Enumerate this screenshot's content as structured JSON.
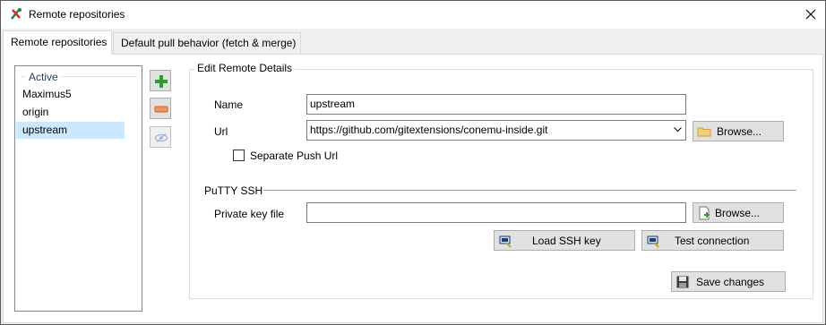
{
  "window": {
    "title": "Remote repositories",
    "close_label": "✕"
  },
  "tabs": [
    {
      "label": "Remote repositories",
      "active": true
    },
    {
      "label": "Default pull behavior (fetch & merge)",
      "active": false
    }
  ],
  "remotes": {
    "header": "Active",
    "items": [
      {
        "label": "Maximus5",
        "selected": false
      },
      {
        "label": "origin",
        "selected": false
      },
      {
        "label": "upstream",
        "selected": true
      }
    ]
  },
  "side_buttons": {
    "add": "add-icon",
    "remove": "remove-icon",
    "toggle": "eye-hidden-icon"
  },
  "details": {
    "legend": "Edit Remote Details",
    "name_label": "Name",
    "name_value": "upstream",
    "url_label": "Url",
    "url_value": "https://github.com/gitextensions/conemu-inside.git",
    "browse_label": "Browse...",
    "separate_push_label": "Separate Push Url",
    "separate_push_checked": false
  },
  "putty": {
    "legend": "PuTTY SSH",
    "key_label": "Private key file",
    "key_value": "",
    "browse_label": "Browse...",
    "load_key_label": "Load SSH key",
    "test_label": "Test connection"
  },
  "save_label": "Save changes",
  "colors": {
    "selection": "#cce8ff",
    "button_face": "#e1e1e1",
    "header_text": "#1e395b"
  }
}
